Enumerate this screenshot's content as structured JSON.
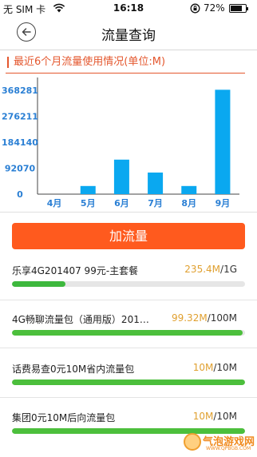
{
  "status_bar": {
    "carrier": "无 SIM 卡",
    "time": "16:18",
    "battery": "72%"
  },
  "header": {
    "title": "流量查询"
  },
  "chart_section": {
    "title": "最近6个月流量使用情况(单位:M)"
  },
  "chart_data": {
    "type": "bar",
    "categories": [
      "4月",
      "5月",
      "6月",
      "7月",
      "8月",
      "9月"
    ],
    "values": [
      0,
      29,
      123,
      77,
      29,
      372
    ],
    "yticks": [
      0,
      92070,
      184140,
      276211,
      368281
    ],
    "ytick_labels": [
      "0",
      "92070",
      "184140",
      "276211",
      "368281"
    ],
    "ylim": [
      0,
      410
    ],
    "bar_color": "#0aa8f0",
    "axis_label_color": "#2a7fd4",
    "grid": false
  },
  "actions": {
    "add_traffic_label": "加流量"
  },
  "packages": [
    {
      "name": "乐享4G201407 99元-主套餐",
      "used": "235.4M",
      "total": "1G",
      "used_fraction": 0.23,
      "bar_color": "#3db83d"
    },
    {
      "name": "4G畅聊流量包（通用版）201…",
      "used": "99.32M",
      "total": "100M",
      "used_fraction": 0.99,
      "bar_color": "#4cbf3c"
    },
    {
      "name": "话费易查0元10M省内流量包",
      "used": "10M",
      "total": "10M",
      "used_fraction": 1.0,
      "bar_color": "#4cbf3c"
    },
    {
      "name": "集团0元10M后向流量包",
      "used": "10M",
      "total": "10M",
      "used_fraction": 1.0,
      "bar_color": "#4cbf3c"
    }
  ],
  "watermark": {
    "text": "气泡游戏网",
    "url": "WWW.QPBGB.COM"
  }
}
